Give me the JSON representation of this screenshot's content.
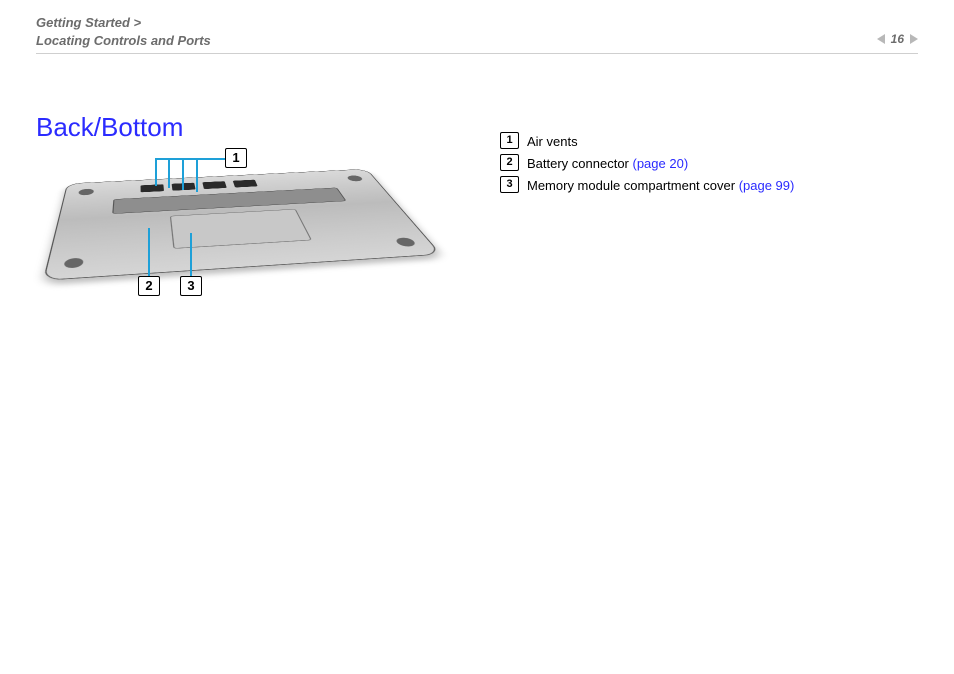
{
  "breadcrumb": {
    "line1": "Getting Started >",
    "line2": "Locating Controls and Ports"
  },
  "page_number": "16",
  "title": "Back/Bottom",
  "callouts": {
    "c1": "1",
    "c2": "2",
    "c3": "3"
  },
  "legend": [
    {
      "num": "1",
      "text": "Air vents",
      "link": ""
    },
    {
      "num": "2",
      "text": "Battery connector ",
      "link": "(page 20)"
    },
    {
      "num": "3",
      "text": "Memory module compartment cover ",
      "link": "(page 99)"
    }
  ]
}
